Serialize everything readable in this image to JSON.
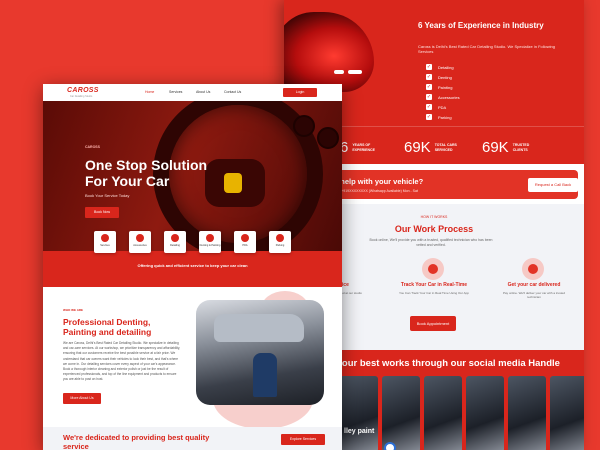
{
  "back_page": {
    "experience_title": "6 Years of Experience in Industry",
    "experience_sub": "Caross is Delhi's Best Rated Car Detailing Studio. We Specialize in Following Services",
    "checklist": [
      "Detailing",
      "Denting",
      "Painting",
      "Accessories",
      "PDA",
      "Parking"
    ],
    "stats": [
      {
        "num": "6",
        "label": "YEARS OF EXPERIENCE"
      },
      {
        "num": "69K",
        "label": "TOTAL CARS SERVICED"
      },
      {
        "num": "69K",
        "label": "TRUSTED CLIENTS"
      }
    ],
    "help_title": "u need help with your vehicle?",
    "help_sub": "mpo, or Call Us - +919XXXXXXXX (Whatsapp Available) Mon - Sat",
    "help_button": "Request a Call Back",
    "process_kicker": "HOW IT WORKS",
    "process_title": "Our Work Process",
    "process_desc": "Book online, We'll provide you with a trusted, qualified technician who has been vetted and verified.",
    "steps": [
      {
        "title": "vice",
        "desc": "Get your car serviced at our studio"
      },
      {
        "title": "Track Your Car in Real-Time",
        "desc": "You Can Track Your Car in Real Time Using Our App"
      },
      {
        "title": "Get your car delivered",
        "desc": "Pay online. We'll deliver your car with a trusted technician"
      }
    ],
    "process_button": "Book Appointment",
    "social_title": "e our best works through our social media Handle",
    "photo_caption": "lley paint"
  },
  "front_page": {
    "nav": {
      "logo": "CAROSS",
      "logo_sub": "Car Detailing Studio",
      "items": [
        "Home",
        "Services",
        "About Us",
        "Contact Us"
      ],
      "login": "Login"
    },
    "hero": {
      "kicker": "CAROSS",
      "title": "One Stop Solution For Your Car",
      "subtitle": "Book Your Service Today",
      "button": "Book Now"
    },
    "services": [
      "Services",
      "Accessories",
      "Detailing",
      "Denting & Painting",
      "PDA",
      "Parking"
    ],
    "band_text": "Offering quick and efficient service to keep your car clean",
    "about": {
      "kicker": "WHO WE ARE",
      "title": "Professional Denting, Painting and detailing",
      "body": "We are Caross, Delhi's Best Rated Car Detailing Studio. We specialize in detailing and car-care services. At our workshop, we prioritize transparency and affordability, ensuring that our customers receive the best possible service at a fair price. We understand that car owners want their vehicles to look their best, and that's where we come in. Our detailing services cover every aspect of your car's appearance. Book a thorough interior cleaning and exterior polish or just be the result of experienced professionals, and top of the line equipment and products to ensure you are able to post on host.",
      "button": "More About Us"
    },
    "dedicated": {
      "title": "We're dedicated to providing best quality service",
      "button": "Explore Services"
    }
  },
  "colors": {
    "brand_red": "#d9261c",
    "light_bg": "#f2f3f7"
  },
  "icons": [
    "check-icon",
    "wrench-icon",
    "car-icon",
    "paint-icon",
    "parking-icon"
  ]
}
